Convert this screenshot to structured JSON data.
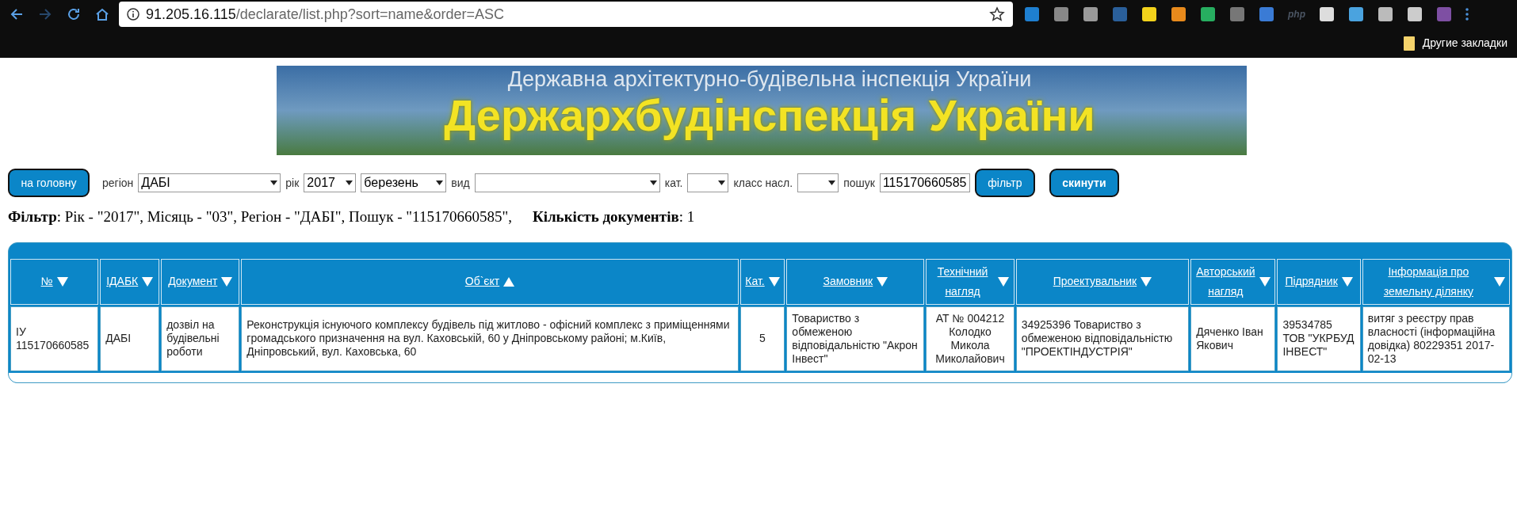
{
  "browser": {
    "url_host": "91.205.16.115",
    "url_path": "/declarate/list.php?sort=name&order=ASC",
    "extension_label": "php",
    "bookmarks_folder": "Другие закладки"
  },
  "banner": {
    "subtitle": "Державна архітектурно-будівельна інспекція України",
    "title": "Держархбудінспекція України"
  },
  "filter_form": {
    "home_button": "на головну",
    "fields": [
      {
        "label": "регіон",
        "value": "ДАБІ",
        "kind": "select"
      },
      {
        "label": "рік",
        "value": "2017",
        "kind": "select"
      },
      {
        "value": "березень",
        "kind": "select"
      },
      {
        "label": "вид",
        "kind": "select"
      },
      {
        "label": "кат.",
        "kind": "select"
      },
      {
        "label": "класс насл.",
        "kind": "select"
      },
      {
        "label": "пошук",
        "value": "115170660585",
        "kind": "input"
      }
    ],
    "buttons": [
      {
        "label": "фільтр",
        "bold": false
      },
      {
        "label": "скинути",
        "bold": true
      }
    ]
  },
  "filter_summary": "**Фільтр**: Рік - \"2017\", Місяць - \"03\", Регіон - \"ДАБІ\", Пошук - \"115170660585\",",
  "document_count": "**Кількість документів**: 1",
  "table": {
    "columns": [
      {
        "label": "№",
        "sort_ascending": false
      },
      {
        "label": "ІДАБК",
        "sort_ascending": false
      },
      {
        "label": "Документ",
        "sort_ascending": false
      },
      {
        "label": "Об`єкт",
        "sort_ascending": true
      },
      {
        "label": "Кат.",
        "sort_ascending": false
      },
      {
        "label": "Замовник",
        "sort_ascending": false
      },
      {
        "label": "Технічний нагляд",
        "sort_ascending": false
      },
      {
        "label": "Проектувальник",
        "sort_ascending": false
      },
      {
        "label": "Авторський нагляд",
        "sort_ascending": false
      },
      {
        "label": "Підрядник",
        "sort_ascending": false
      },
      {
        "label": "Інформація про земельну ділянку",
        "sort_ascending": false
      }
    ],
    "rows": [
      [
        "ІУ 115170660585",
        "ДАБІ",
        "дозвіл на будівельні роботи",
        "Реконструкція існуючого комплексу будівель під житлово - офісний комплекс з приміщеннями громадського призначення на вул. Каховській, 60 у Дніпровському районі; м.Київ, Дніпровський, вул. Каховська, 60",
        "5",
        "Товариство з обмеженою відповідальністю \"Акрон Інвест\"",
        "АТ № 004212 Колодко Микола Миколайович",
        "34925396 Товариство з обмеженою відповідальністю \"ПРОЕКТІНДУСТРІЯ\"",
        "Дяченко Іван Якович",
        "39534785 ТОВ \"УКРБУД ІНВЕСТ\"",
        "витяг з реєстру прав власності (інформаційна довідка) 80229351 2017-02-13"
      ]
    ]
  }
}
